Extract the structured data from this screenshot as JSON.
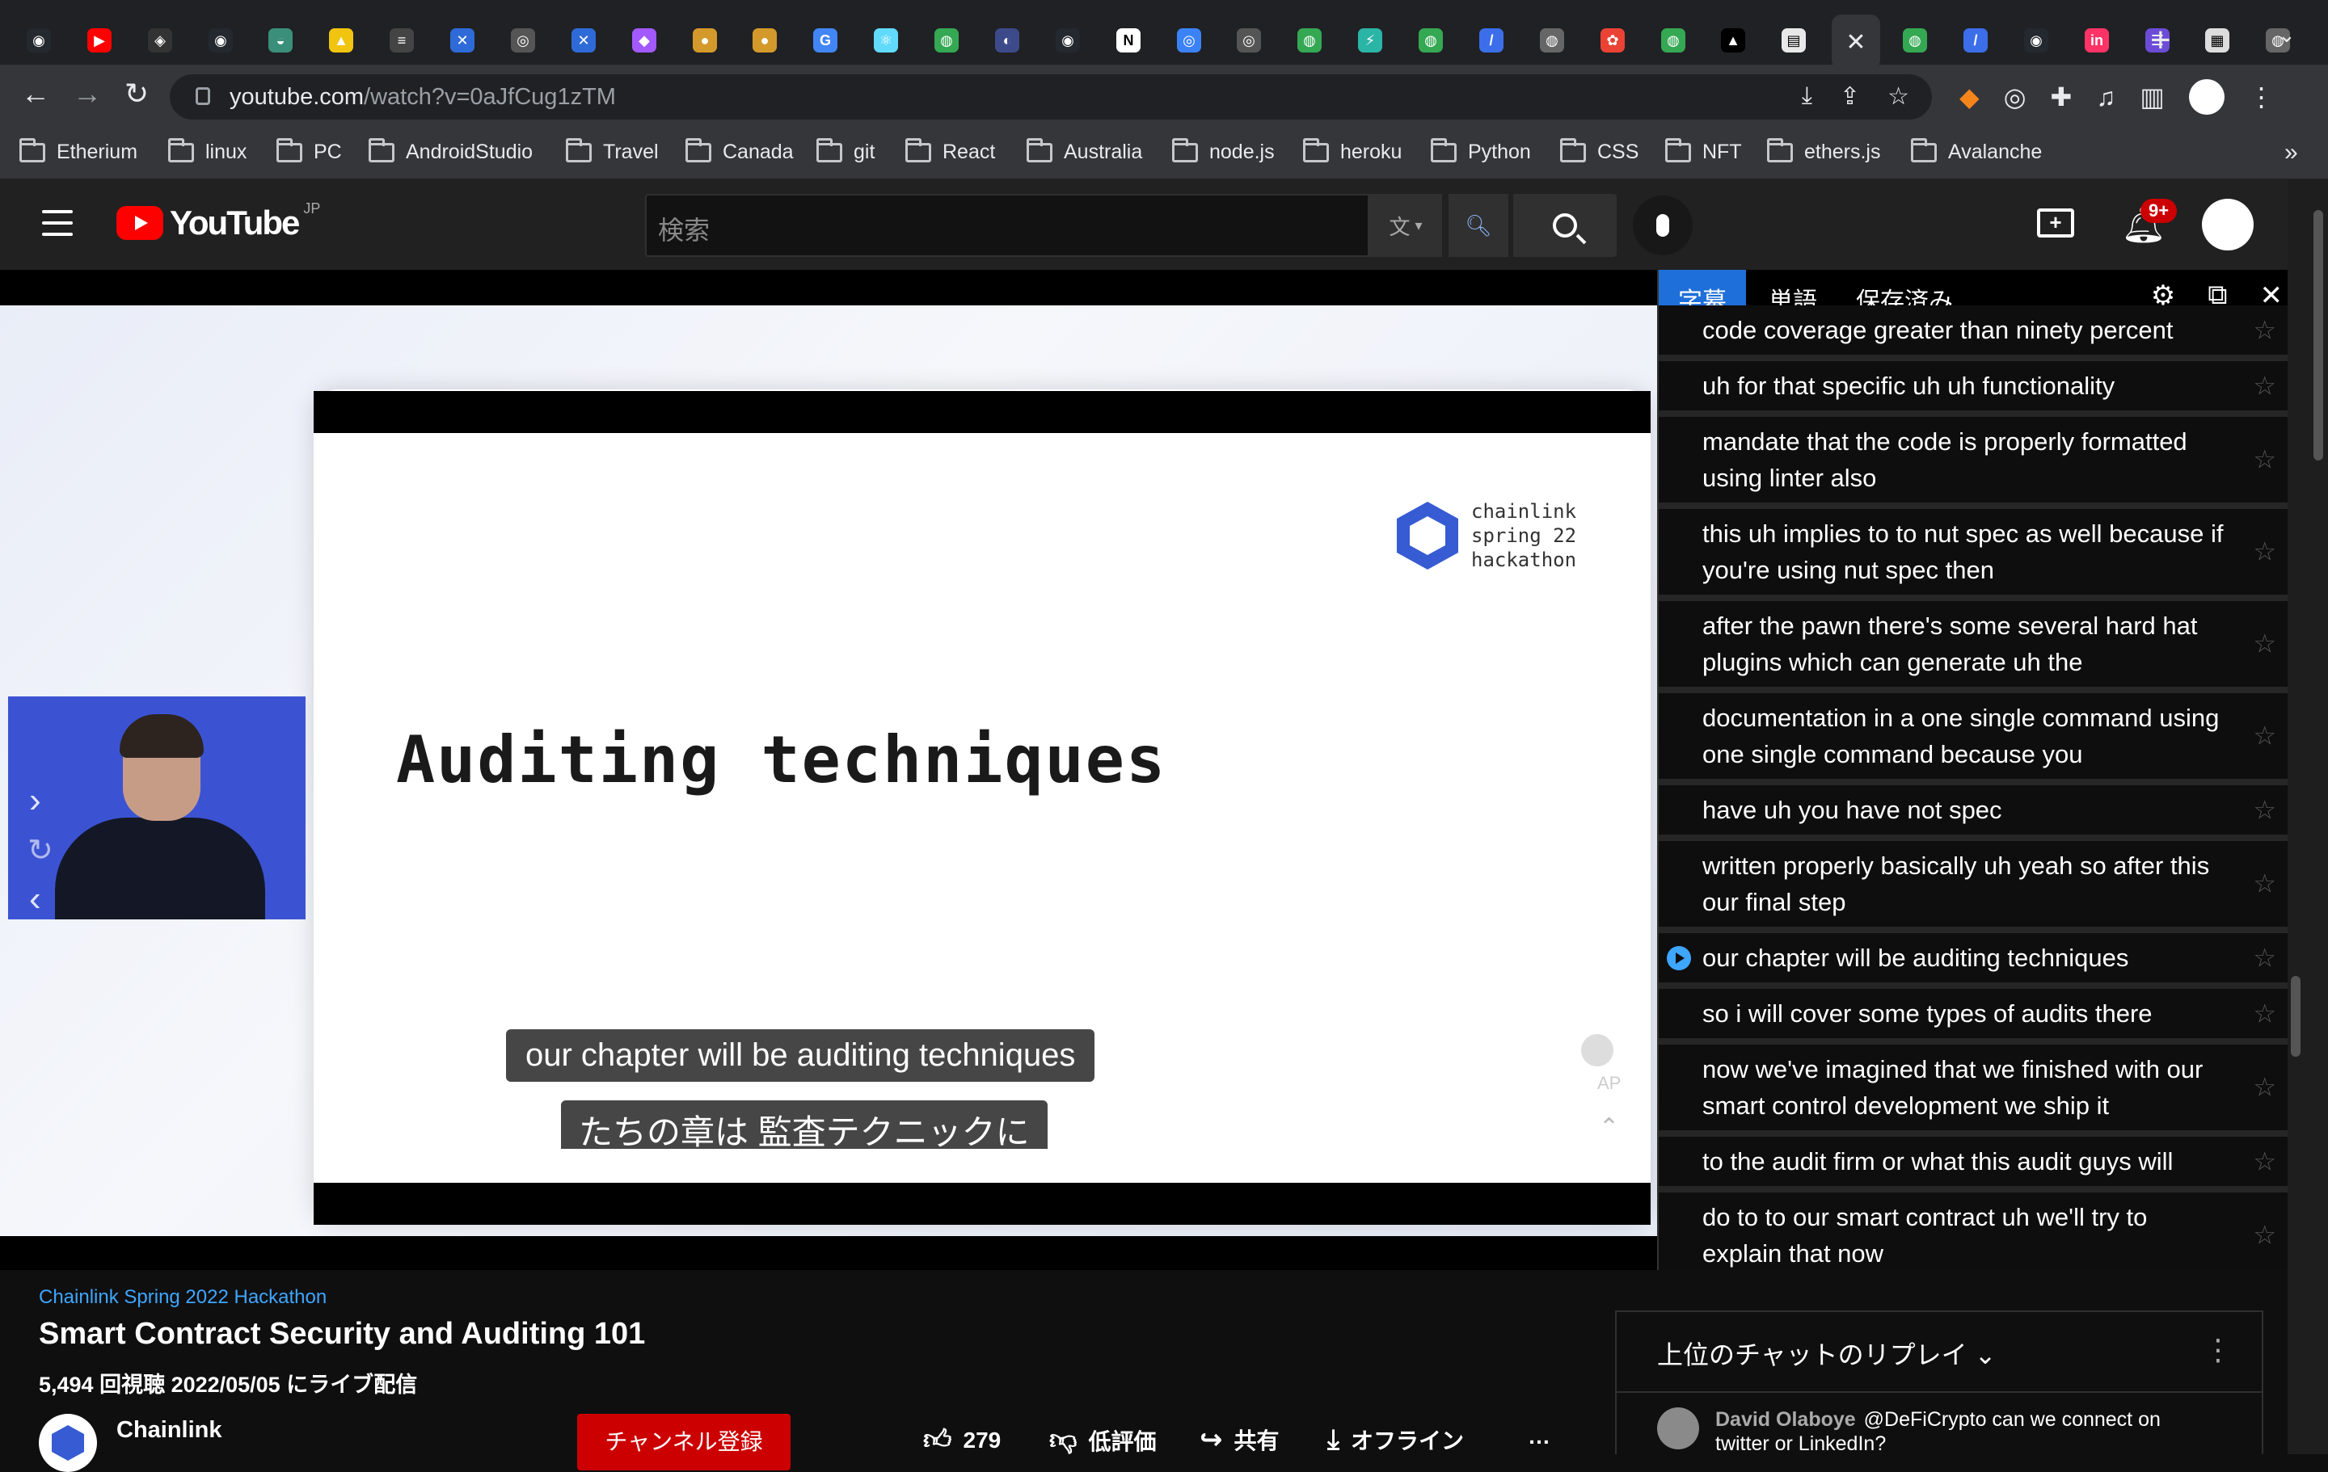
{
  "browser": {
    "url_host": "youtube.com",
    "url_path": "/watch?v=0aJfCug1zTM",
    "tabs": [
      {
        "icon": "github-icon",
        "color": "#24292f",
        "glyph": "◉"
      },
      {
        "icon": "youtube-icon",
        "color": "#ff0000",
        "glyph": "▶"
      },
      {
        "icon": "codesandbox-icon",
        "color": "#333333",
        "glyph": "◈"
      },
      {
        "icon": "github-icon",
        "color": "#24292f",
        "glyph": "◉"
      },
      {
        "icon": "hardhat-icon",
        "color": "#3a8f7a",
        "glyph": "◒"
      },
      {
        "icon": "warning-icon",
        "color": "#f1c40f",
        "glyph": "▲"
      },
      {
        "icon": "notes-icon",
        "color": "#444444",
        "glyph": "≡"
      },
      {
        "icon": "bluesky-icon",
        "color": "#2f6bd8",
        "glyph": "✕"
      },
      {
        "icon": "chrome-icon",
        "color": "#555555",
        "glyph": "◎"
      },
      {
        "icon": "bluesky-icon",
        "color": "#2f6bd8",
        "glyph": "✕"
      },
      {
        "icon": "figma-icon",
        "color": "#a259ff",
        "glyph": "◆"
      },
      {
        "icon": "cookie-icon",
        "color": "#d39a2b",
        "glyph": "●"
      },
      {
        "icon": "cookie-icon",
        "color": "#d39a2b",
        "glyph": "●"
      },
      {
        "icon": "google-icon",
        "color": "#4285f4",
        "glyph": "G"
      },
      {
        "icon": "react-icon",
        "color": "#61dafb",
        "glyph": "⚛"
      },
      {
        "icon": "remix-icon",
        "color": "#34a853",
        "glyph": "◍"
      },
      {
        "icon": "moon-icon",
        "color": "#3d4a8a",
        "glyph": "◐"
      },
      {
        "icon": "github-icon",
        "color": "#24292f",
        "glyph": "◉"
      },
      {
        "icon": "notion-icon",
        "color": "#ffffff",
        "glyph": "N"
      },
      {
        "icon": "safari-icon",
        "color": "#3b82f6",
        "glyph": "◎"
      },
      {
        "icon": "chrome-icon",
        "color": "#555555",
        "glyph": "◎"
      },
      {
        "icon": "remix-icon",
        "color": "#34a853",
        "glyph": "◍"
      },
      {
        "icon": "bolt-icon",
        "color": "#2bb5a7",
        "glyph": "⚡"
      },
      {
        "icon": "remix-icon",
        "color": "#34a853",
        "glyph": "◍"
      },
      {
        "icon": "slash-icon",
        "color": "#3b6ee8",
        "glyph": "/"
      },
      {
        "icon": "globe-icon",
        "color": "#666666",
        "glyph": "◍"
      },
      {
        "icon": "photos-icon",
        "color": "#ea4335",
        "glyph": "✿"
      },
      {
        "icon": "remix-icon",
        "color": "#34a853",
        "glyph": "◍"
      },
      {
        "icon": "vercel-icon",
        "color": "#000000",
        "glyph": "▲"
      },
      {
        "icon": "document-icon",
        "color": "#e8e8e8",
        "glyph": "▤"
      },
      {
        "icon": "close-icon",
        "color": "#35363a",
        "glyph": "✕",
        "active": true
      },
      {
        "icon": "remix-icon",
        "color": "#34a853",
        "glyph": "◍"
      },
      {
        "icon": "slash-icon",
        "color": "#3b6ee8",
        "glyph": "/"
      },
      {
        "icon": "github-icon",
        "color": "#24292f",
        "glyph": "◉"
      },
      {
        "icon": "invision-icon",
        "color": "#ff3366",
        "glyph": "in"
      },
      {
        "icon": "form-icon",
        "color": "#6c4cd6",
        "glyph": "☰"
      },
      {
        "icon": "jsc-icon",
        "color": "#dddddd",
        "glyph": "▦"
      },
      {
        "icon": "globe-icon",
        "color": "#666666",
        "glyph": "◍"
      }
    ],
    "bookmarks": [
      "Etherium",
      "linux",
      "PC",
      "AndroidStudio",
      "Travel",
      "Canada",
      "git",
      "React",
      "Australia",
      "node.js",
      "heroku",
      "Python",
      "CSS",
      "NFT",
      "ethers.js",
      "Avalanche"
    ]
  },
  "youtube": {
    "region": "JP",
    "logo_text": "YouTube",
    "search_placeholder": "検索",
    "notification_count": "9+"
  },
  "video": {
    "slide_title": "Auditing techniques",
    "slide_logo_text": "chainlink\nspring 22\nhackathon",
    "caption_en": "our chapter will be auditing techniques",
    "caption_ja": "たちの章は 監査テクニックに",
    "autoplay_label": "AP"
  },
  "subtitle_panel": {
    "tabs": [
      "字幕",
      "単語",
      "保存済み"
    ],
    "items": [
      {
        "text": "code coverage greater than ninety percent"
      },
      {
        "text": "uh for that specific uh uh functionality"
      },
      {
        "text": "mandate that the code is properly formatted using linter also"
      },
      {
        "text": "this uh implies to to nut spec as well because if you're using nut spec then"
      },
      {
        "text": "after the pawn there's some several hard hat plugins which can generate uh the"
      },
      {
        "text": "documentation in a one single command using one single command because you"
      },
      {
        "text": "have uh you have not spec"
      },
      {
        "text": "written properly basically uh yeah so after this our final step"
      },
      {
        "text": "our chapter will be auditing techniques",
        "playing": true
      },
      {
        "text": "so i will cover some types of audits there"
      },
      {
        "text": "now we've imagined that we finished with our smart control development we ship it"
      },
      {
        "text": "to the audit firm or what this audit guys will"
      },
      {
        "text": "do to to our smart contract uh we'll try to explain that now"
      }
    ]
  },
  "details": {
    "hashtag": "Chainlink Spring 2022 Hackathon",
    "title": "Smart Contract Security and Auditing 101",
    "meta": "5,494 回視聴  2022/05/05 にライブ配信",
    "channel": "Chainlink",
    "subscribe_label": "チャンネル登録",
    "like_count": "279",
    "dislike_label": "低評価",
    "share_label": "共有",
    "offline_label": "オフライン",
    "more_label": "…"
  },
  "chat": {
    "title": "上位のチャットのリプレイ",
    "message_author": "David Olaboye",
    "message_text": "@DeFiCrypto can we connect on twitter or LinkedIn?"
  }
}
